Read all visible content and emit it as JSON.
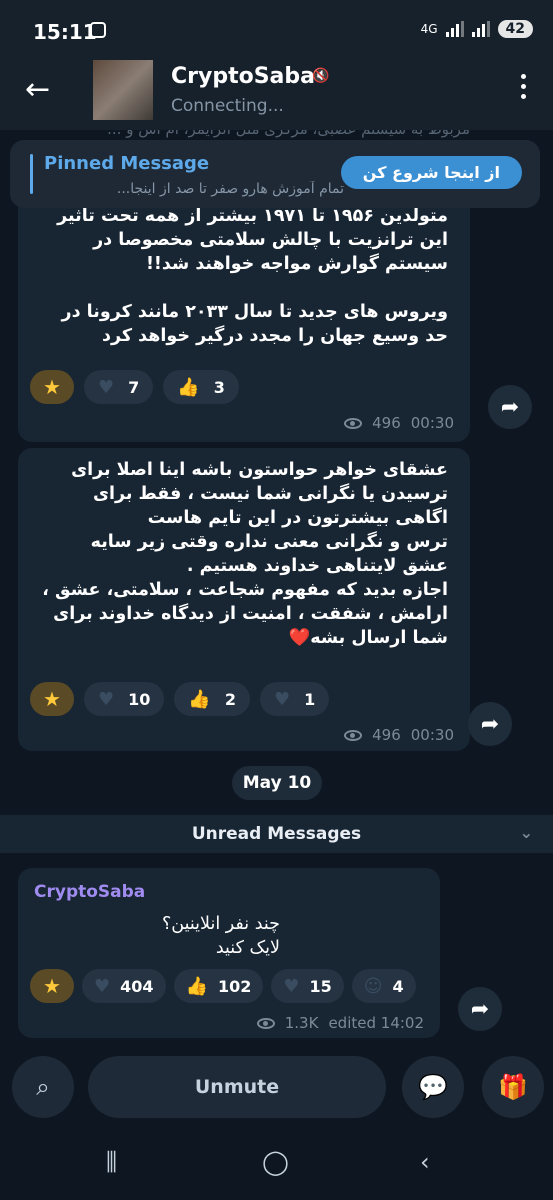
{
  "status_bar": {
    "time": "15:11",
    "network": "4G",
    "battery": "42"
  },
  "header": {
    "title": "CryptoSaba",
    "status": "Connecting..."
  },
  "pinned": {
    "label": "Pinned Message",
    "text": "تمام آموزش هارو صفر تا صد از اینجا...",
    "button": "از اینجا شروع کن",
    "behind_text": "مربوط به سیستم عصبی، مرکزی مثل آلزایمر، ام اس و ..."
  },
  "messages": [
    {
      "text": "متولدین ۱۹۵۶ تا ۱۹۷۱ بیشتر از همه تحت تاثیر این ترانزیت با چالش سلامتی مخصوصا در سیستم گوارش مواجه خواهند شد!!\n\nویروس های جدید تا سال ۲۰۳۳ مانند کرونا در حد وسیع جهان را مجدد درگیر خواهد کرد",
      "reactions": [
        {
          "icon": "star",
          "count": ""
        },
        {
          "icon": "heart",
          "count": "7"
        },
        {
          "icon": "thumbs-up",
          "count": "3"
        }
      ],
      "views": "496",
      "time": "00:30"
    },
    {
      "text": "عشقای خواهر حواستون باشه اینا اصلا برای ترسیدن یا نگرانی شما نیست ، فقط برای اگاهی بیشترتون در این تایم هاست\nترس و نگرانی معنی نداره وقتی زیر سایه عشق لایتناهی خداوند هستیم .\nاجازه بدید که مفهوم شجاعت ، سلامتی، عشق ، ارامش ، شفقت ، امنیت از دیدگاه خداوند برای شما ارسال بشه❤️",
      "reactions": [
        {
          "icon": "star",
          "count": ""
        },
        {
          "icon": "heart",
          "count": "10"
        },
        {
          "icon": "thumbs-up",
          "count": "2"
        },
        {
          "icon": "heart-hands",
          "count": "1"
        }
      ],
      "views": "496",
      "time": "00:30"
    },
    {
      "sender": "CryptoSaba",
      "text": "چند نفر انلاینین؟\nلایک کنید",
      "reactions": [
        {
          "icon": "star",
          "count": ""
        },
        {
          "icon": "heart",
          "count": "404"
        },
        {
          "icon": "thumbs-up",
          "count": "102"
        },
        {
          "icon": "heart-hands",
          "count": "15"
        },
        {
          "icon": "face",
          "count": "4"
        }
      ],
      "views": "1.3K",
      "time": "edited 14:02"
    }
  ],
  "date_separator": "May 10",
  "unread_label": "Unread Messages",
  "bottom": {
    "unmute_label": "Unmute"
  }
}
